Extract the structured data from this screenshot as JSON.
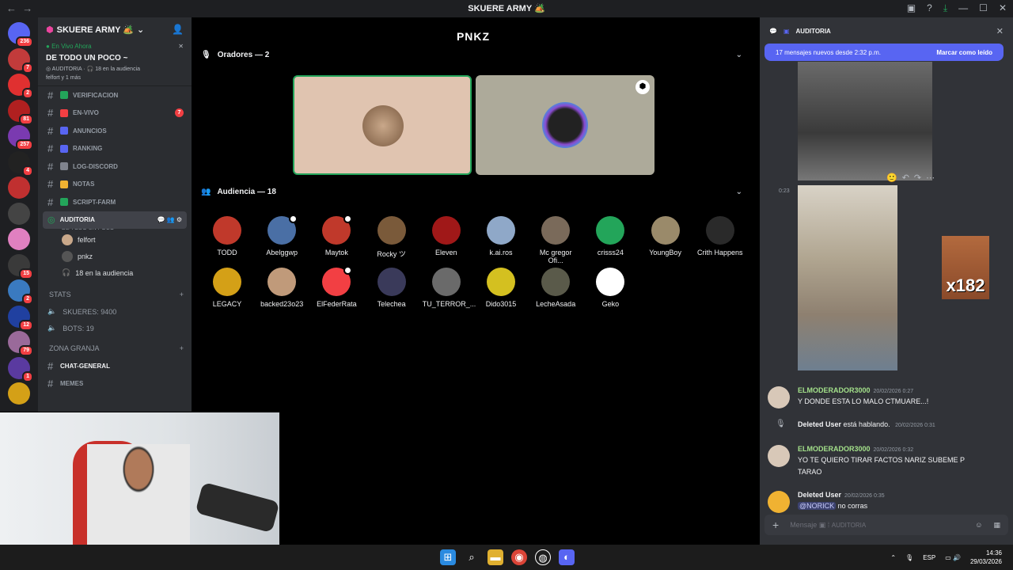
{
  "window": {
    "title": "SKUERE ARMY 🏕️"
  },
  "servers": [
    {
      "badge": "236"
    },
    {
      "badge": "7"
    },
    {
      "badge": "2"
    },
    {
      "badge": "81"
    },
    {
      "badge": "257"
    },
    {
      "badge": "4"
    },
    {
      "badge": ""
    },
    {
      "badge": ""
    },
    {
      "badge": ""
    },
    {
      "badge": "15"
    },
    {
      "badge": "2"
    },
    {
      "badge": "12"
    },
    {
      "badge": "79"
    },
    {
      "badge": "1"
    },
    {
      "badge": ""
    }
  ],
  "guild": {
    "name": "SKUERE ARMY 🏕️",
    "live_label": "En Vivo Ahora",
    "live_title": "DE TODO UN POCO ~",
    "live_channel": "AUDITORIA",
    "live_audience": "18 en la audiencia",
    "live_users": "felfort y 1 más"
  },
  "channels": [
    {
      "name": "VERIFICACION",
      "color": "#23a55a"
    },
    {
      "name": "EN-VIVO",
      "color": "#f23f43",
      "badge": "7"
    },
    {
      "name": "ANUNCIOS",
      "color": "#5865f2"
    },
    {
      "name": "RANKING",
      "color": "#5865f2"
    },
    {
      "name": "LOG-DISCORD",
      "color": "#80848e"
    },
    {
      "name": "NOTAS",
      "color": "#f0b232"
    },
    {
      "name": "SCRIPT-FARM",
      "color": "#23a55a"
    }
  ],
  "selected_channel": {
    "name": "AUDITORIA",
    "subtitle": "DE TODO UN POCO ~"
  },
  "voice_users": [
    {
      "name": "felfort"
    },
    {
      "name": "pnkz"
    }
  ],
  "voice_audience": "18 en la audiencia",
  "categories": {
    "stats": "STATS",
    "zona": "ZONA GRANJA"
  },
  "stats": [
    {
      "label": "SKUERES: 9400"
    },
    {
      "label": "BOTS: 19"
    }
  ],
  "zona_channels": [
    {
      "name": "CHAT-GENERAL"
    },
    {
      "name": "MEMES"
    }
  ],
  "stage": {
    "logo": "PNKZ",
    "speakers_label": "Oradores — 2",
    "audience_label": "Audiencia — 18"
  },
  "audience": [
    {
      "name": "TODD",
      "color": "#c0392b"
    },
    {
      "name": "Abelggwp",
      "color": "#4a6fa5"
    },
    {
      "name": "Maytok",
      "color": "#c0392b"
    },
    {
      "name": "Rocky ツ",
      "color": "#7a5a3a"
    },
    {
      "name": "Eleven",
      "color": "#a01818"
    },
    {
      "name": "k.ai.ros",
      "color": "#8fa8c8"
    },
    {
      "name": "Mc gregor Ofi...",
      "color": "#7a6a5a"
    },
    {
      "name": "crisss24",
      "color": "#23a55a"
    },
    {
      "name": "YoungBoy",
      "color": "#9a8a6a"
    },
    {
      "name": "Crith Happens",
      "color": "#2a2a2a"
    },
    {
      "name": "LEGACY",
      "color": "#d4a017"
    },
    {
      "name": "backed23o23",
      "color": "#c09a7a"
    },
    {
      "name": "ElFederRata",
      "color": "#f23f43"
    },
    {
      "name": "Telechea",
      "color": "#3a3a5a"
    },
    {
      "name": "TU_TERROR_...",
      "color": "#6a6a6a"
    },
    {
      "name": "Dido3015",
      "color": "#d4c020"
    },
    {
      "name": "LecheAsada",
      "color": "#5a5a4a"
    },
    {
      "name": "Geko",
      "color": "#ffffff"
    }
  ],
  "chat": {
    "channel": "AUDITORIA",
    "banner_text": "17 mensajes nuevos desde 2:32 p.m.",
    "banner_action": "Marcar como leído",
    "image_time": "0:23",
    "image_text": "x182",
    "messages": [
      {
        "user": "ELMODERADOR3000",
        "time": "20/02/2026 0:27",
        "text": "Y DONDE ESTA LO MALO CTMUARE...!",
        "color": "#a3e08a"
      },
      {
        "user": "Deleted User",
        "time": "20/02/2026 0:31",
        "text": "está hablando.",
        "color": "#f2f3f5"
      },
      {
        "user": "ELMODERADOR3000",
        "time": "20/02/2026 0:32",
        "text": "YO TE QUIERO TIRAR FACTOS NARIZ SUBEME P TARAO",
        "color": "#a3e08a"
      },
      {
        "user": "Deleted User",
        "time": "20/02/2026 0:35",
        "mention": "@NORICK",
        "text": "no corras",
        "color": "#f2f3f5"
      }
    ],
    "placeholder": "Mensaje",
    "placeholder_channel": "AUDITORIA"
  },
  "taskbar": {
    "lang": "ESP",
    "time": "14:36",
    "date": "29/03/2026"
  }
}
